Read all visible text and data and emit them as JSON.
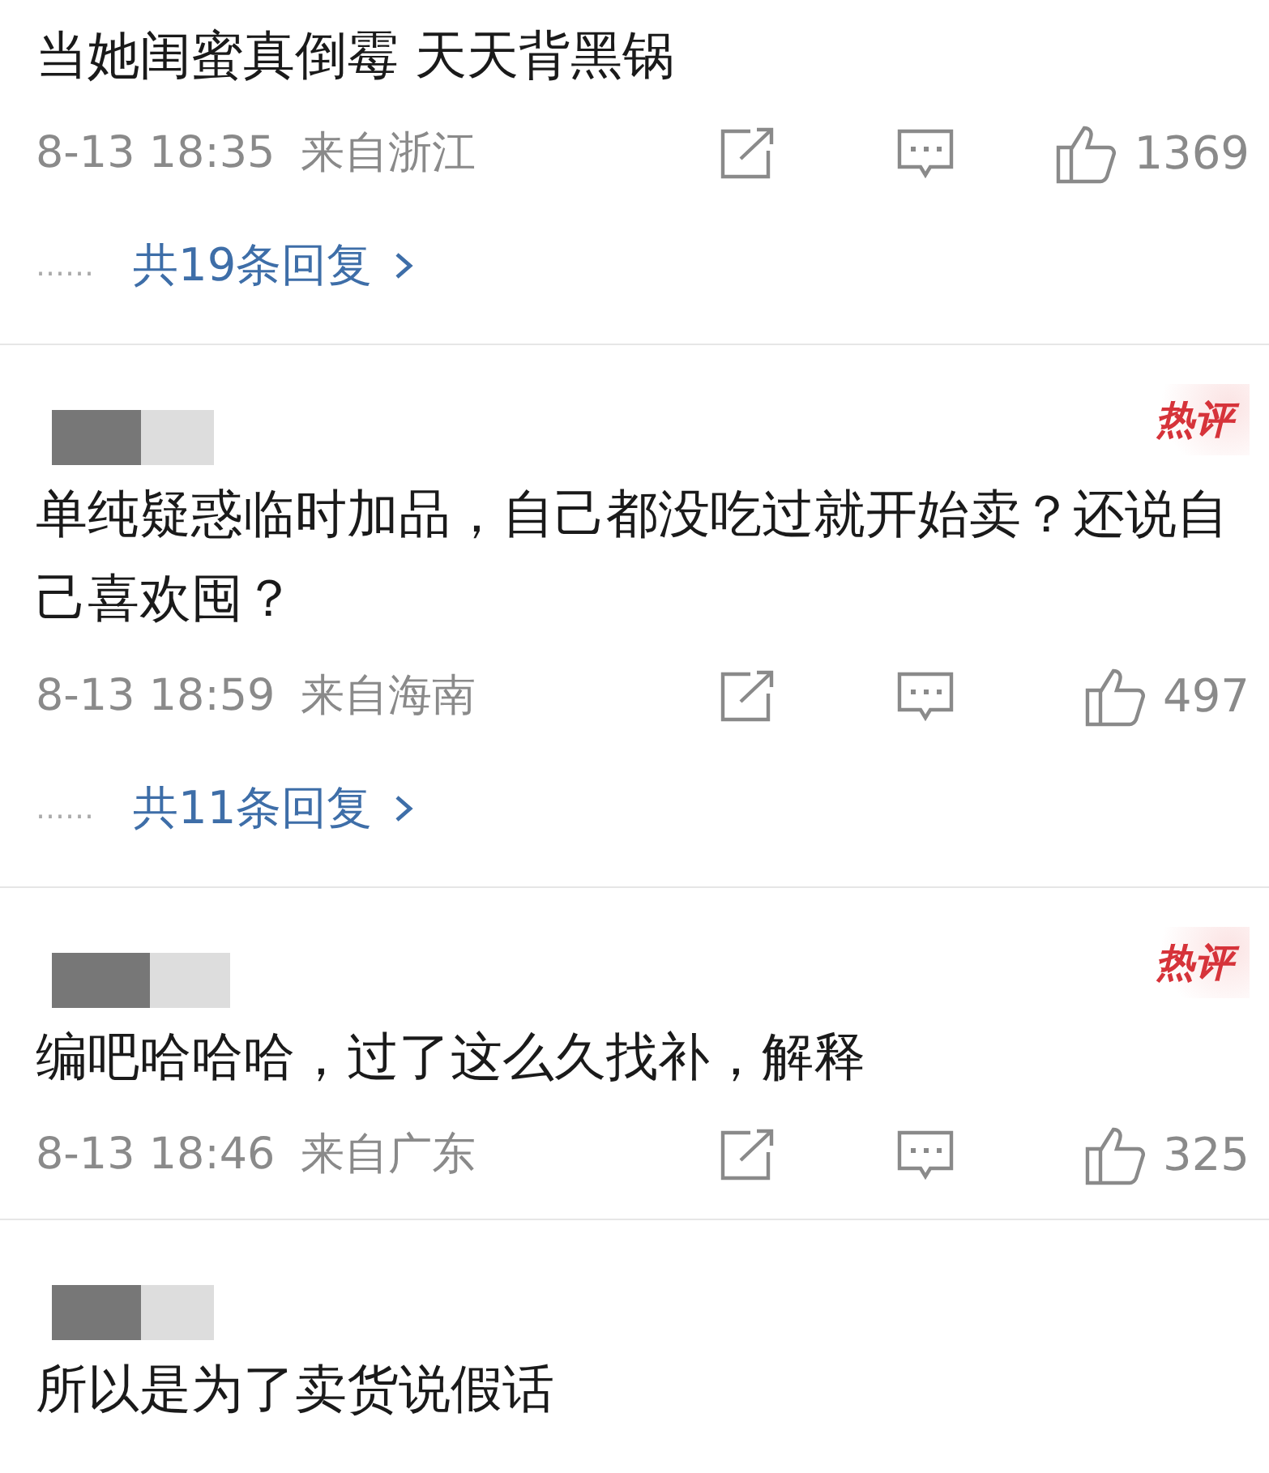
{
  "comments": [
    {
      "kind": "continued",
      "text": "当她闺蜜真倒霉 天天背黑锅",
      "time": "8-13 18:35",
      "location": "来自浙江",
      "likes": "1369",
      "reply_dots": "……",
      "replies": "共19条回复"
    },
    {
      "kind": "full",
      "badge": "热评",
      "text": "单纯疑惑临时加品，自己都没吃过就开始卖？还说自己喜欢囤？",
      "time": "8-13 18:59",
      "location": "来自海南",
      "likes": "497",
      "reply_dots": "……",
      "replies": "共11条回复"
    },
    {
      "kind": "full",
      "badge": "热评",
      "text": "编吧哈哈哈，过了这么久找补，解释",
      "time": "8-13 18:46",
      "location": "来自广东",
      "likes": "325"
    },
    {
      "kind": "full",
      "text": "所以是为了卖货说假话"
    }
  ]
}
